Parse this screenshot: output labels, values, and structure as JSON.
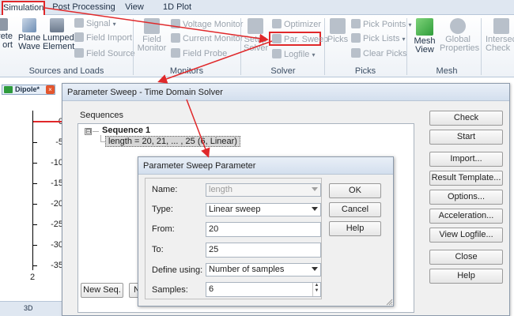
{
  "ribbon": {
    "tabs": [
      {
        "label": "Simulation"
      },
      {
        "label": "Post Processing"
      },
      {
        "label": "View"
      },
      {
        "label": "1D Plot"
      }
    ],
    "buttons": {
      "discrete_port": "rete\nort",
      "plane_wave": "Plane\nWave",
      "lumped_element": "Lumped\nElement",
      "signal": "Signal",
      "field_import": "Field Import",
      "field_source": "Field Source",
      "field_monitor": "Field\nMonitor",
      "voltage_monitor": "Voltage Monitor",
      "current_monitor": "Current Monitor",
      "field_probe": "Field Probe",
      "setup_solver": "Setup\nSolver",
      "optimizer": "Optimizer",
      "par_sweep": "Par. Sweep",
      "logfile": "Logfile",
      "picks": "Picks",
      "pick_points": "Pick Points",
      "pick_lists": "Pick Lists",
      "clear_picks": "Clear Picks",
      "mesh_view": "Mesh\nView",
      "global_properties": "Global\nProperties",
      "intersect_check": "Intersec\nCheck"
    },
    "groups": {
      "sources": "Sources and Loads",
      "monitors": "Monitors",
      "solver": "Solver",
      "picks": "Picks",
      "mesh": "Mesh"
    }
  },
  "document": {
    "tab_label": "Dipole*",
    "close_glyph": "×",
    "y_ticks": [
      "0",
      "-5",
      "-10",
      "-15",
      "-20",
      "-25",
      "-30",
      "-35"
    ],
    "x_tick": "2",
    "status_label": "3D"
  },
  "sweep_dialog": {
    "title": "Parameter Sweep - Time Domain Solver",
    "sequences_label": "Sequences",
    "tree_expander": "⊟",
    "sequence_name": "Sequence 1",
    "sequence_param": "length = 20, 21, ... , 25 (6, Linear)",
    "buttons": {
      "check": "Check",
      "start": "Start",
      "import": "Import...",
      "result_template": "Result Template...",
      "options": "Options...",
      "acceleration": "Acceleration...",
      "view_logfile": "View Logfile...",
      "close": "Close",
      "help": "Help",
      "new_seq": "New Seq.",
      "new_par": "N"
    }
  },
  "param_dialog": {
    "title": "Parameter Sweep Parameter",
    "fields": {
      "name_label": "Name:",
      "name_value": "length",
      "type_label": "Type:",
      "type_value": "Linear sweep",
      "from_label": "From:",
      "from_value": "20",
      "to_label": "To:",
      "to_value": "25",
      "define_label": "Define using:",
      "define_value": "Number of samples",
      "samples_label": "Samples:",
      "samples_value": "6"
    },
    "buttons": {
      "ok": "OK",
      "cancel": "Cancel",
      "help": "Help"
    }
  },
  "colors": {
    "annotation_red": "#e0282a",
    "ribbon_bg": "#dfe7f1"
  }
}
